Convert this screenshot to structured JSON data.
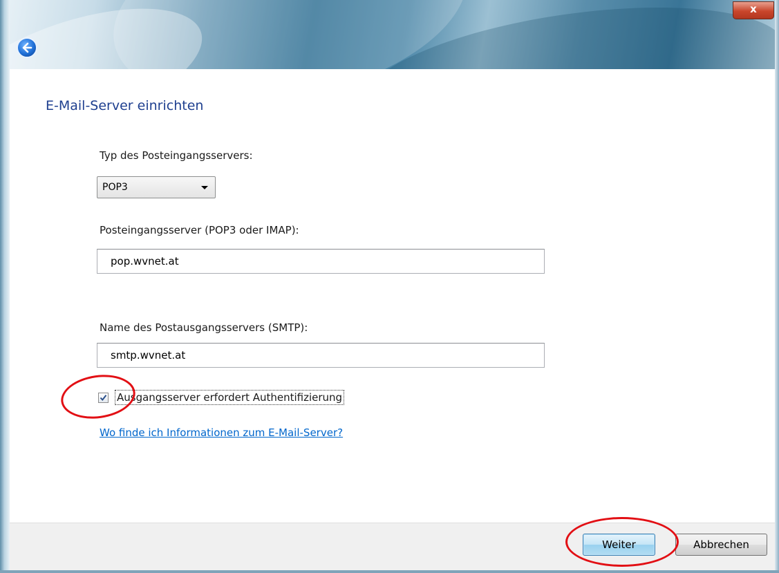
{
  "window": {
    "close_glyph": "x",
    "back_icon": "back-arrow-icon"
  },
  "page_title": "E-Mail-Server einrichten",
  "incoming_type": {
    "label": "Typ des Posteingangsservers:",
    "selected": "POP3",
    "options": [
      "POP3"
    ]
  },
  "incoming_server": {
    "label": "Posteingangsserver (POP3 oder IMAP):",
    "value": "pop.wvnet.at"
  },
  "outgoing_server": {
    "label": "Name des Postausgangsservers (SMTP):",
    "value": "smtp.wvnet.at"
  },
  "auth_checkbox": {
    "label": "Ausgangsserver erfordert Authentifizierung",
    "checked": true
  },
  "help_link": "Wo finde ich Informationen zum E-Mail-Server?",
  "buttons": {
    "next": "Weiter",
    "cancel": "Abbrechen"
  },
  "colors": {
    "title": "#1e3f8f",
    "link": "#0066cc",
    "annotation": "#e20f14",
    "close_button": "#c9462c"
  }
}
